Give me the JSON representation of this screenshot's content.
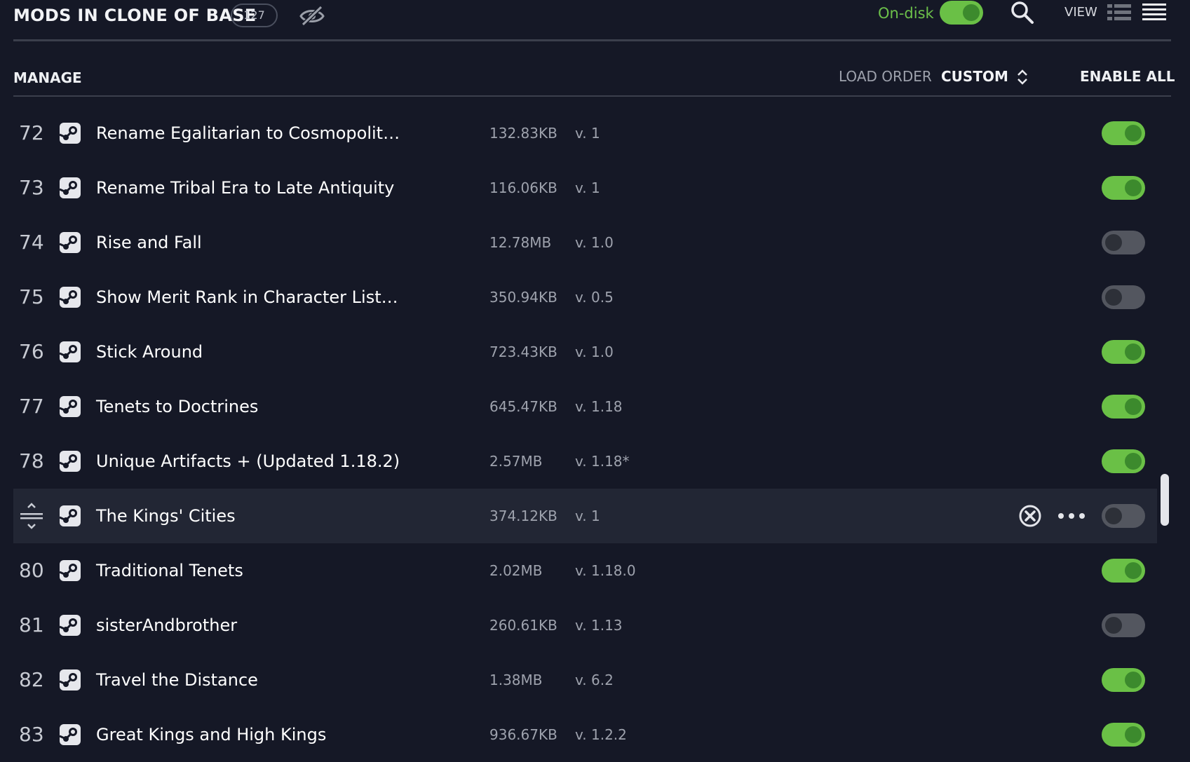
{
  "header": {
    "title": "MODS IN CLONE OF BASE",
    "count": "127",
    "ondisk_label": "On-disk",
    "ondisk_enabled": true,
    "view_label": "VIEW"
  },
  "manage": {
    "label": "MANAGE",
    "load_order_label": "LOAD ORDER",
    "load_order_value": "CUSTOM",
    "enable_all_label": "ENABLE ALL"
  },
  "colors": {
    "accent_green": "#6ac046",
    "background": "#151826",
    "selected_row": "#222634"
  },
  "mods": [
    {
      "index": "72",
      "name": "Rename Egalitarian to Cosmopolit…",
      "size": "132.83KB",
      "version": "v. 1",
      "enabled": true
    },
    {
      "index": "73",
      "name": "Rename Tribal Era to Late Antiquity",
      "size": "116.06KB",
      "version": "v. 1",
      "enabled": true
    },
    {
      "index": "74",
      "name": "Rise and Fall",
      "size": "12.78MB",
      "version": "v. 1.0",
      "enabled": false
    },
    {
      "index": "75",
      "name": "Show Merit Rank in Character List…",
      "size": "350.94KB",
      "version": "v. 0.5",
      "enabled": false
    },
    {
      "index": "76",
      "name": "Stick Around",
      "size": "723.43KB",
      "version": "v. 1.0",
      "enabled": true
    },
    {
      "index": "77",
      "name": "Tenets to Doctrines",
      "size": "645.47KB",
      "version": "v. 1.18",
      "enabled": true
    },
    {
      "index": "78",
      "name": "Unique Artifacts + (Updated 1.18.2)",
      "size": "2.57MB",
      "version": "v. 1.18*",
      "enabled": true
    },
    {
      "index": "",
      "name": "The Kings' Cities",
      "size": "374.12KB",
      "version": "v. 1",
      "enabled": false,
      "selected": true
    },
    {
      "index": "80",
      "name": "Traditional Tenets",
      "size": "2.02MB",
      "version": "v. 1.18.0",
      "enabled": true
    },
    {
      "index": "81",
      "name": "sisterAndbrother",
      "size": "260.61KB",
      "version": "v. 1.13",
      "enabled": false
    },
    {
      "index": "82",
      "name": "Travel the Distance",
      "size": "1.38MB",
      "version": "v. 6.2",
      "enabled": true
    },
    {
      "index": "83",
      "name": "Great Kings and High Kings",
      "size": "936.67KB",
      "version": "v. 1.2.2",
      "enabled": true
    }
  ]
}
